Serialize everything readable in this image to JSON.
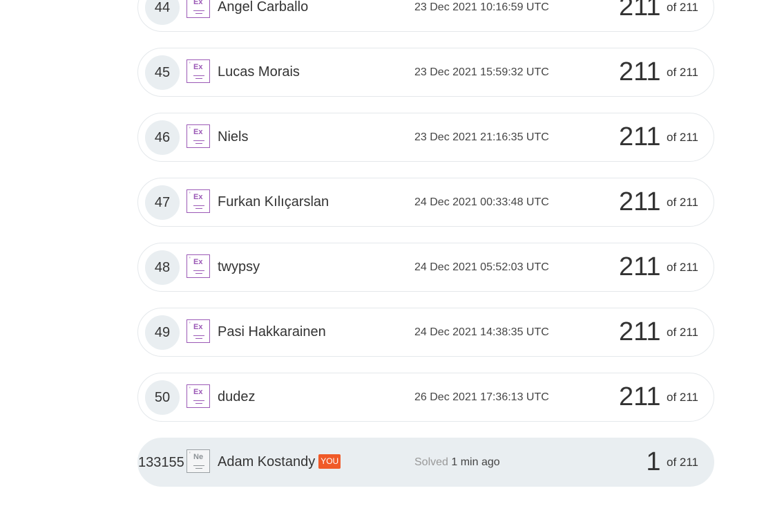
{
  "rows": [
    {
      "rank": "44",
      "badge": "Ex",
      "name": "Angel Carballo",
      "time": "23 Dec 2021 10:16:59 UTC",
      "score": "211",
      "of_label": "of 211"
    },
    {
      "rank": "45",
      "badge": "Ex",
      "name": "Lucas Morais",
      "time": "23 Dec 2021 15:59:32 UTC",
      "score": "211",
      "of_label": "of 211"
    },
    {
      "rank": "46",
      "badge": "Ex",
      "name": "Niels",
      "time": "23 Dec 2021 21:16:35 UTC",
      "score": "211",
      "of_label": "of 211"
    },
    {
      "rank": "47",
      "badge": "Ex",
      "name": "Furkan Kılıçarslan",
      "time": "24 Dec 2021 00:33:48 UTC",
      "score": "211",
      "of_label": "of 211"
    },
    {
      "rank": "48",
      "badge": "Ex",
      "name": "twypsy",
      "time": "24 Dec 2021 05:52:03 UTC",
      "score": "211",
      "of_label": "of 211"
    },
    {
      "rank": "49",
      "badge": "Ex",
      "name": "Pasi Hakkarainen",
      "time": "24 Dec 2021 14:38:35 UTC",
      "score": "211",
      "of_label": "of 211"
    },
    {
      "rank": "50",
      "badge": "Ex",
      "name": "dudez",
      "time": "26 Dec 2021 17:36:13 UTC",
      "score": "211",
      "of_label": "of 211"
    }
  ],
  "you_row": {
    "rank": "133155",
    "badge": "Ne",
    "name": "Adam Kostandy",
    "you_tag": "YOU",
    "solved_label": "Solved",
    "solved_ago": "1 min ago",
    "score": "1",
    "of_label": "of 211"
  },
  "colors": {
    "expert_badge": "#9b59b6",
    "newbie_badge": "#8c9296",
    "you_tag_bg": "#f05a28",
    "you_row_bg": "#e9eef1",
    "rank_circle_bg": "#e9eef1"
  },
  "icons": {
    "expert_badge": "expert-element-badge-icon",
    "newbie_badge": "newbie-element-badge-icon"
  }
}
